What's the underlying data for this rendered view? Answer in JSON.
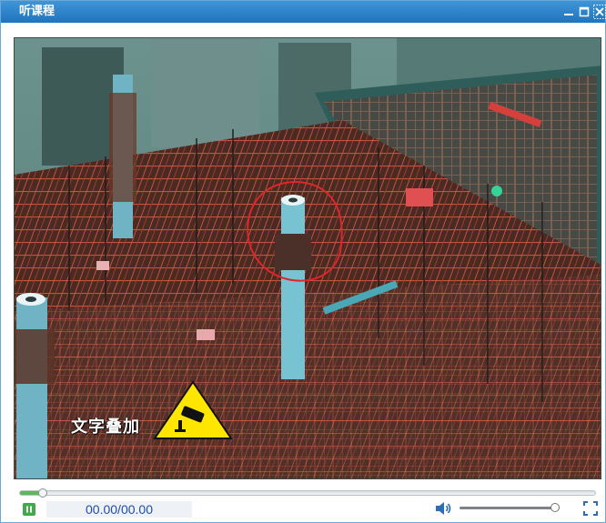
{
  "window": {
    "title": "听课程"
  },
  "video": {
    "overlay_text": "文字叠加",
    "progress_fraction": 0.04,
    "time_display": "00.00/00.00",
    "volume_fraction": 0.95
  },
  "icons": {
    "minimize": "minimize-icon",
    "maximize": "maximize-icon",
    "close": "close-icon",
    "pause": "pause-icon",
    "volume": "speaker-icon",
    "fullscreen": "fullscreen-icon",
    "warning": "camera-warning-icon"
  },
  "colors": {
    "titlebar": "#2a83c9",
    "time_text": "#1f4ea5",
    "play_button": "#41a94b",
    "warning_yellow": "#ffe600"
  }
}
